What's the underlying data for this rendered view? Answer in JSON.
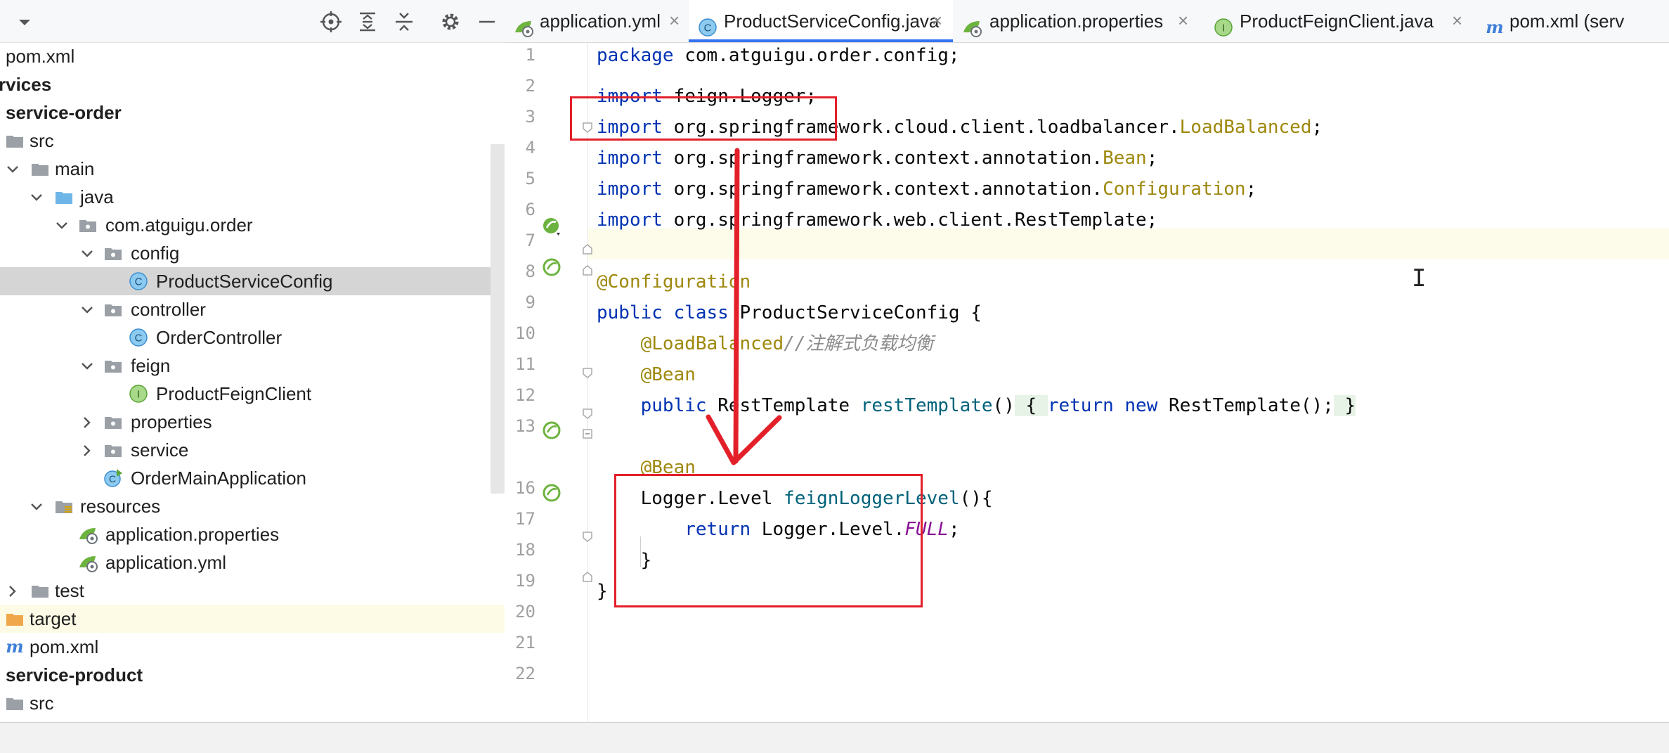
{
  "tree": [
    {
      "label": "pom.xml",
      "bold": false,
      "icon": "maven-file-icon",
      "chev": "",
      "selected": false
    },
    {
      "label": "rvices",
      "bold": true,
      "icon": "",
      "chev": "",
      "selected": false
    },
    {
      "label": "service-order",
      "bold": true,
      "icon": "",
      "chev": "",
      "selected": false
    },
    {
      "label": "src",
      "bold": false,
      "icon": "folder-icon",
      "chev": "",
      "selected": false
    },
    {
      "label": "main",
      "bold": false,
      "icon": "folder-icon",
      "chev": "down",
      "selected": false
    },
    {
      "label": "java",
      "bold": false,
      "icon": "source-folder-icon",
      "chev": "down",
      "selected": false
    },
    {
      "label": "com.atguigu.order",
      "bold": false,
      "icon": "package-icon",
      "chev": "down",
      "selected": false
    },
    {
      "label": "config",
      "bold": false,
      "icon": "package-icon",
      "chev": "down",
      "selected": false
    },
    {
      "label": "ProductServiceConfig",
      "bold": false,
      "icon": "class-icon",
      "chev": "",
      "selected": true
    },
    {
      "label": "controller",
      "bold": false,
      "icon": "package-icon",
      "chev": "down",
      "selected": false
    },
    {
      "label": "OrderController",
      "bold": false,
      "icon": "class-icon",
      "chev": "",
      "selected": false
    },
    {
      "label": "feign",
      "bold": false,
      "icon": "package-icon",
      "chev": "down",
      "selected": false
    },
    {
      "label": "ProductFeignClient",
      "bold": false,
      "icon": "interface-icon",
      "chev": "",
      "selected": false
    },
    {
      "label": "properties",
      "bold": false,
      "icon": "package-icon",
      "chev": "right",
      "selected": false
    },
    {
      "label": "service",
      "bold": false,
      "icon": "package-icon",
      "chev": "right",
      "selected": false
    },
    {
      "label": "OrderMainApplication",
      "bold": false,
      "icon": "spring-app-class-icon",
      "chev": "",
      "selected": false
    },
    {
      "label": "resources",
      "bold": false,
      "icon": "resources-folder-icon",
      "chev": "down",
      "selected": false
    },
    {
      "label": "application.properties",
      "bold": false,
      "icon": "spring-config-icon",
      "chev": "",
      "selected": false
    },
    {
      "label": "application.yml",
      "bold": false,
      "icon": "spring-config-icon",
      "chev": "",
      "selected": false
    },
    {
      "label": "test",
      "bold": false,
      "icon": "folder-icon",
      "chev": "right",
      "selected": false
    },
    {
      "label": "target",
      "bold": false,
      "icon": "excluded-folder-icon",
      "chev": "",
      "selected": false
    },
    {
      "label": "pom.xml",
      "bold": false,
      "icon": "maven-file-icon",
      "chev": "",
      "selected": false
    },
    {
      "label": "service-product",
      "bold": true,
      "icon": "",
      "chev": "",
      "selected": false
    },
    {
      "label": "src",
      "bold": false,
      "icon": "folder-icon",
      "chev": "",
      "selected": false
    }
  ],
  "tabs": [
    {
      "label": "application.yml",
      "icon": "spring-config-icon",
      "active": false,
      "close": "×"
    },
    {
      "label": "ProductServiceConfig.java",
      "icon": "class-icon",
      "active": true,
      "close": "×"
    },
    {
      "label": "application.properties",
      "icon": "spring-config-icon",
      "active": false,
      "close": "×"
    },
    {
      "label": "ProductFeignClient.java",
      "icon": "interface-icon",
      "active": false,
      "close": "×"
    },
    {
      "label": "pom.xml (serv",
      "icon": "maven-file-icon",
      "active": false,
      "close": ""
    }
  ],
  "line_numbers": [
    "1",
    "2",
    "3",
    "4",
    "5",
    "6",
    "7",
    "8",
    "9",
    "10",
    "11",
    "12",
    "13",
    "16",
    "17",
    "18",
    "19",
    "20",
    "21",
    "22"
  ],
  "code": {
    "l1": {
      "kw": "package",
      "rest": " com.atguigu.order.config;"
    },
    "l3": {
      "kw": "import",
      "rest": " feign.Logger;"
    },
    "l4": {
      "kw": "import",
      "rest": " org.springframework.cloud.client.loadbalancer.",
      "ann": "LoadBalanced",
      "end": ";"
    },
    "l5": {
      "kw": "import",
      "rest": " org.springframework.context.annotation.",
      "ann": "Bean",
      "end": ";"
    },
    "l6": {
      "kw": "import",
      "rest": " org.springframework.context.annotation.",
      "ann": "Configuration",
      "end": ";"
    },
    "l7": {
      "kw": "import",
      "rest": " org.springframework.web.client.RestTemplate;"
    },
    "l9": {
      "ann": "@Configuration"
    },
    "l10": {
      "kw": "public class",
      "rest": " ProductServiceConfig {"
    },
    "l11": {
      "ann": "@LoadBalanced",
      "cmt": "//注解式负载均衡"
    },
    "l12": {
      "ann": "@Bean"
    },
    "l13": {
      "kw1": "public",
      "type": " RestTemplate ",
      "fn": "restTemplate",
      "paren": "()",
      "brace_open": " { ",
      "kw2": "return",
      "kw3": " new",
      "rest": " RestTemplate();",
      "brace_close": " }"
    },
    "l17": {
      "ann": "@Bean"
    },
    "l18": {
      "type": "Logger.Level ",
      "fn": "feignLoggerLevel",
      "rest": "(){"
    },
    "l19": {
      "kw": "return",
      "rest": " Logger.Level.",
      "enumc": "FULL",
      "end": ";"
    },
    "l20": {
      "rest": "}"
    },
    "l21": {
      "rest": "}"
    }
  },
  "colors": {
    "annotation_red": "#e3202a",
    "tab_accent": "#3574f0",
    "keyword": "#0033b3",
    "annotation": "#9e880d"
  }
}
